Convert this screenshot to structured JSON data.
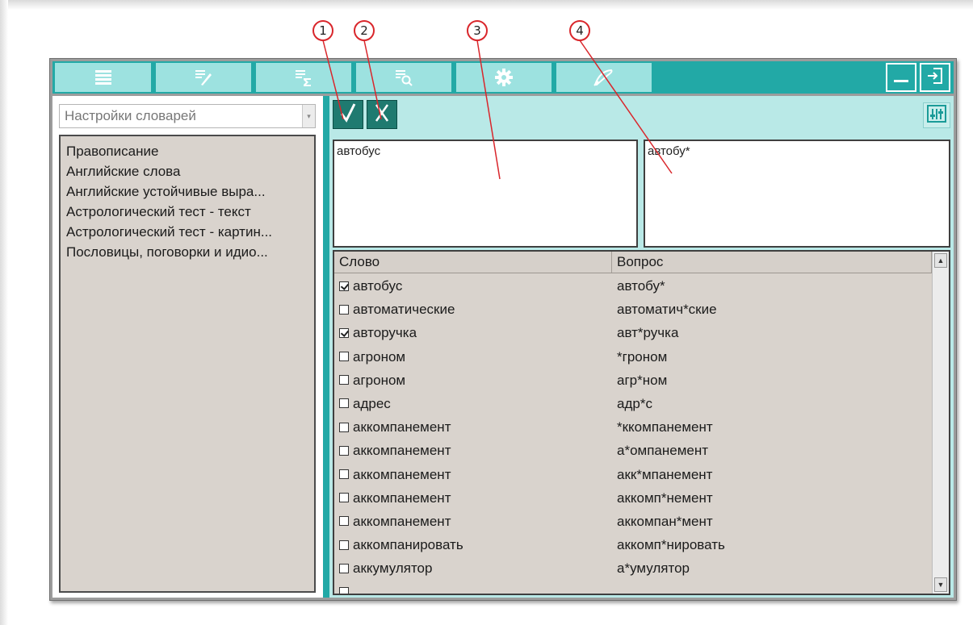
{
  "toolbar": {
    "tabs": [
      {
        "icon": "list-icon"
      },
      {
        "icon": "dictionary-edit-icon"
      },
      {
        "icon": "dictionary-sum-icon"
      },
      {
        "icon": "dictionary-search-icon"
      },
      {
        "icon": "gear-icon"
      },
      {
        "icon": "pen-icon"
      }
    ],
    "minimize_icon": "minimize-icon",
    "exit_icon": "exit-icon"
  },
  "left_panel": {
    "dictionary_select": {
      "value": "Настройки словарей"
    },
    "dictionaries": [
      "Правописание",
      "Английские слова",
      "Английские устойчивые выра...",
      "Астрологический тест - текст",
      "Астрологический тест - картин...",
      "Пословицы, поговорки и идио..."
    ]
  },
  "editor": {
    "ok_icon": "checkmark-icon",
    "cancel_icon": "cancel-icon",
    "columns_icon": "column-settings-icon",
    "word_value": "автобус",
    "question_value": "автобу*"
  },
  "grid": {
    "columns": [
      "Слово",
      "Вопрос"
    ],
    "rows": [
      {
        "checked": true,
        "word": "автобус",
        "question": "автобу*"
      },
      {
        "checked": false,
        "word": "автоматические",
        "question": "автоматич*ские"
      },
      {
        "checked": true,
        "word": "авторучка",
        "question": "авт*ручка"
      },
      {
        "checked": false,
        "word": "агроном",
        "question": "*гроном"
      },
      {
        "checked": false,
        "word": "агроном",
        "question": "агр*ном"
      },
      {
        "checked": false,
        "word": "адрес",
        "question": "адр*с"
      },
      {
        "checked": false,
        "word": "аккомпанемент",
        "question": "*ккомпанемент"
      },
      {
        "checked": false,
        "word": "аккомпанемент",
        "question": "а*омпанемент"
      },
      {
        "checked": false,
        "word": "аккомпанемент",
        "question": "акк*мпанемент"
      },
      {
        "checked": false,
        "word": "аккомпанемент",
        "question": "аккомп*немент"
      },
      {
        "checked": false,
        "word": "аккомпанемент",
        "question": "аккомпан*мент"
      },
      {
        "checked": false,
        "word": "аккомпанировать",
        "question": "аккомп*нировать"
      },
      {
        "checked": false,
        "word": "аккумулятор",
        "question": "а*умулятор"
      },
      {
        "checked": false,
        "word": "",
        "question": ""
      }
    ]
  },
  "callouts": [
    "1",
    "2",
    "3",
    "4"
  ],
  "colors": {
    "accent": "#22a9a6",
    "tab": "#9de2e0",
    "panel_light": "#b9e9e7",
    "list_bg": "#d9d3cd",
    "button_dark": "#1f7a70",
    "callout": "#d9262b"
  }
}
